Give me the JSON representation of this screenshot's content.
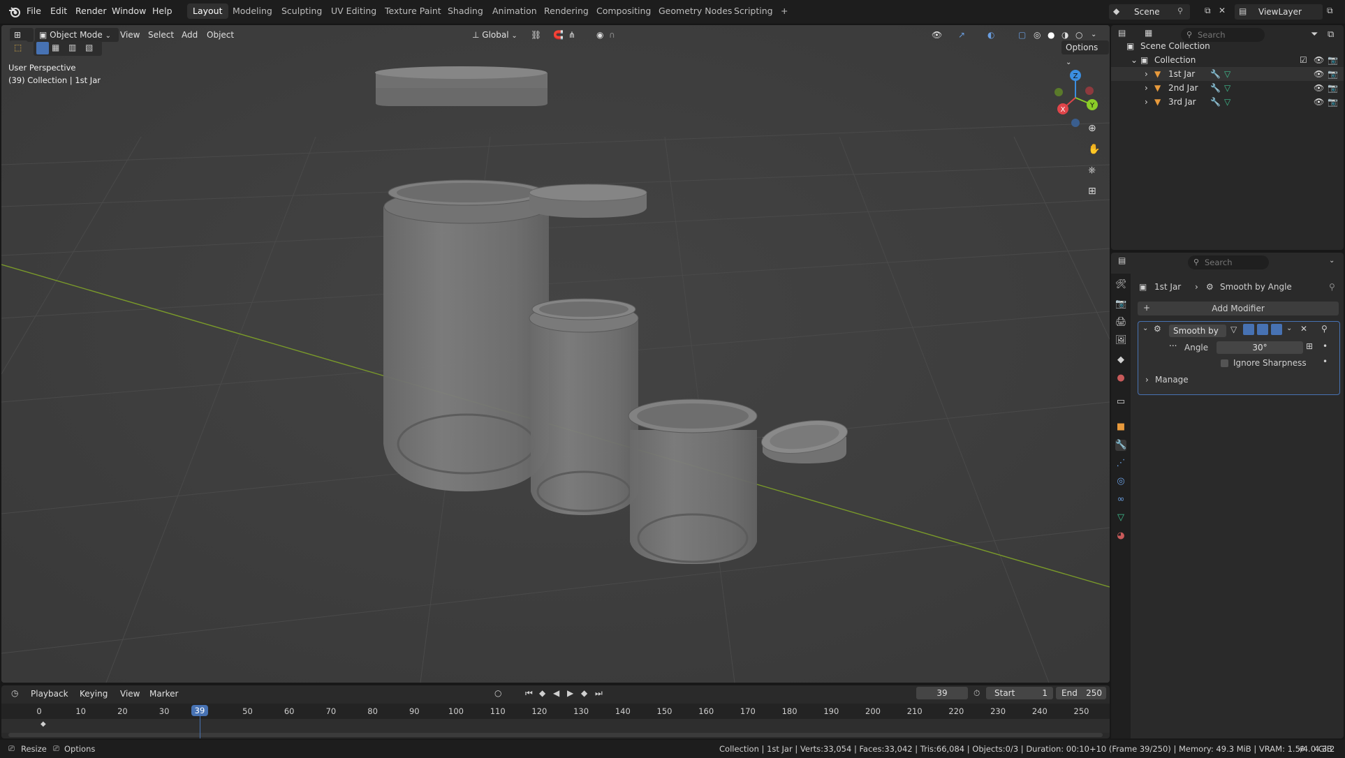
{
  "menu": {
    "file": "File",
    "edit": "Edit",
    "render": "Render",
    "window": "Window",
    "help": "Help"
  },
  "workspaces": [
    "Layout",
    "Modeling",
    "Sculpting",
    "UV Editing",
    "Texture Paint",
    "Shading",
    "Animation",
    "Rendering",
    "Compositing",
    "Geometry Nodes",
    "Scripting"
  ],
  "workspace_add": "+",
  "scene": {
    "name": "Scene",
    "view_layer": "ViewLayer"
  },
  "viewport": {
    "mode": "Object Mode",
    "view": "View",
    "select": "Select",
    "add": "Add",
    "object": "Object",
    "orientation": "Global",
    "options": "Options",
    "overlay_line1": "User Perspective",
    "overlay_line2": "(39) Collection | 1st Jar",
    "gizmo": {
      "z": "Z",
      "y": "Y",
      "x": "X"
    }
  },
  "outliner": {
    "search_placeholder": "Search",
    "scene_collection": "Scene Collection",
    "collection": "Collection",
    "items": [
      "1st Jar",
      "2nd Jar",
      "3rd Jar"
    ]
  },
  "properties": {
    "search_placeholder": "Search",
    "breadcrumb_object": "1st Jar",
    "breadcrumb_modifier": "Smooth by Angle",
    "add_modifier": "Add Modifier",
    "modifier_name": "Smooth by ...",
    "angle_label": "Angle",
    "angle_value": "30°",
    "ignore_sharpness": "Ignore Sharpness",
    "manage": "Manage"
  },
  "timeline": {
    "playback": "Playback",
    "keying": "Keying",
    "view": "View",
    "marker": "Marker",
    "current_frame": "39",
    "start_label": "Start",
    "start": "1",
    "end_label": "End",
    "end": "250",
    "ticks": [
      "0",
      "10",
      "20",
      "30",
      "39",
      "50",
      "60",
      "70",
      "80",
      "90",
      "100",
      "110",
      "120",
      "130",
      "140",
      "150",
      "160",
      "170",
      "180",
      "190",
      "200",
      "210",
      "220",
      "230",
      "240",
      "250"
    ]
  },
  "status": {
    "resize": "Resize",
    "options": "Options",
    "info": "Collection | 1st Jar | Verts:33,054 | Faces:33,042 | Tris:66,084 | Objects:0/3 | Duration: 00:10+10 (Frame 39/250) | Memory: 49.3 MiB | VRAM: 1.5/4.0 GiB",
    "version": "4.3.2"
  },
  "colors": {
    "accent": "#4772b3",
    "x_axis": "#e0454a",
    "y_axis": "#8bcd28",
    "z_axis": "#3b8ee0",
    "active_frame": "#4772b3"
  }
}
